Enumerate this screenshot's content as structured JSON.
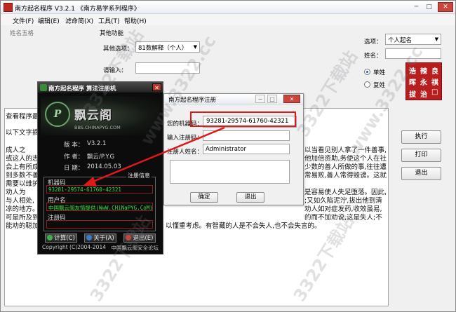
{
  "main_window": {
    "title": "南方起名程序 V3.2.1   《南方易学系列程序》",
    "controls": {
      "minimize": "─",
      "maximize": "□",
      "close": "✕"
    }
  },
  "menu": [
    "文件(F)",
    "编辑(E)",
    "滤命简(X)",
    "工具(T)",
    "帮助(H)"
  ],
  "left_group_label": "姓名五格",
  "other_functions": {
    "label": "其他功能",
    "function_options_label": "其他选项：",
    "function_options_value": "81数解释（个人）",
    "input_label": "请输入："
  },
  "right_panel": {
    "option_label": "选项：",
    "option_value": "个人起名",
    "surname_label": "姓名：",
    "radio_single": "单姓",
    "radio_compound": "复姓",
    "radio_selected": "single",
    "seal_chars": [
      "浩",
      "辣",
      "良",
      "晖",
      "永",
      "祺",
      "拔",
      "治",
      "□"
    ],
    "seal_color": "#b81e1e",
    "buttons": {
      "execute": "执行",
      "print": "打印",
      "exit": "退出"
    }
  },
  "text_area": {
    "lines": [
      "查看程序最",
      "以下文字摘",
      "    成人之",
      "或这人的志",
      "会上有所成",
      "到多数不善",
      "需要以维护",
      "    劝人为",
      "与人相处,",
      "凉的地方。",
      "可是所及到",
      "能劝的聪加"
    ],
    "right_fragments": [
      "以当看见别人拿了一件善事,",
      "他加倍资助,务使这个人在社",
      "少数的善人所做的事,往往遭",
      "常易败,善人常得毁谤。这就",
      "是容易使人失足堕落。因此,",
      ";又如久陷泥泞,拔出他到清",
      "劝人如对症发药,收效虽易,",
      "的而不加劝说,这是失人;不"
    ],
    "bottom_line": "以懂重考虑。有智藏的人是不会失人,也不会失言的。"
  },
  "keygen": {
    "title": "南方起名程序  算法注册机",
    "close": "✕",
    "logo_letter": "P",
    "brand": "飘云阁",
    "site": "BBS.CHINAPYG.COM",
    "info": [
      {
        "key": "版  本：",
        "value": "V3.2.1"
      },
      {
        "key": "作  者：",
        "value": "飘云/P.Y.G"
      },
      {
        "key": "日  期：",
        "value": "2014.05.03"
      }
    ],
    "group_title": "注册信息",
    "machine_code_label": "机器码",
    "machine_code": "93281-29574-61760-42321",
    "user_label": "用户名",
    "user_value": "中国飘云阁友情提供(WwW.CHiNaPYG.CoM)",
    "reg_code_label": "注册码",
    "reg_code_value": "",
    "buttons": {
      "calc": "计算(C)",
      "about": "关于(A)",
      "exit": "退出(E)"
    },
    "footer_left": "Copyright (C)2004-2014",
    "footer_right": "中国飘云阁安全论坛"
  },
  "register_dialog": {
    "title": "南方起名程序注册",
    "machine_code_label": "您的机器码：",
    "machine_code": "93281-29574-61760-42321",
    "reg_code_label": "输入注册码：",
    "reg_code_value": "",
    "username_label": "注册人姓名：",
    "username_value": "Administrator",
    "ok": "确定",
    "cancel": "退出"
  },
  "watermark": "3322下载站",
  "watermark_alt": "www.3322.cc",
  "accent_colors": {
    "highlight": "#e01818",
    "keygen_green": "#36e036",
    "keygen_border": "#8a2020"
  }
}
